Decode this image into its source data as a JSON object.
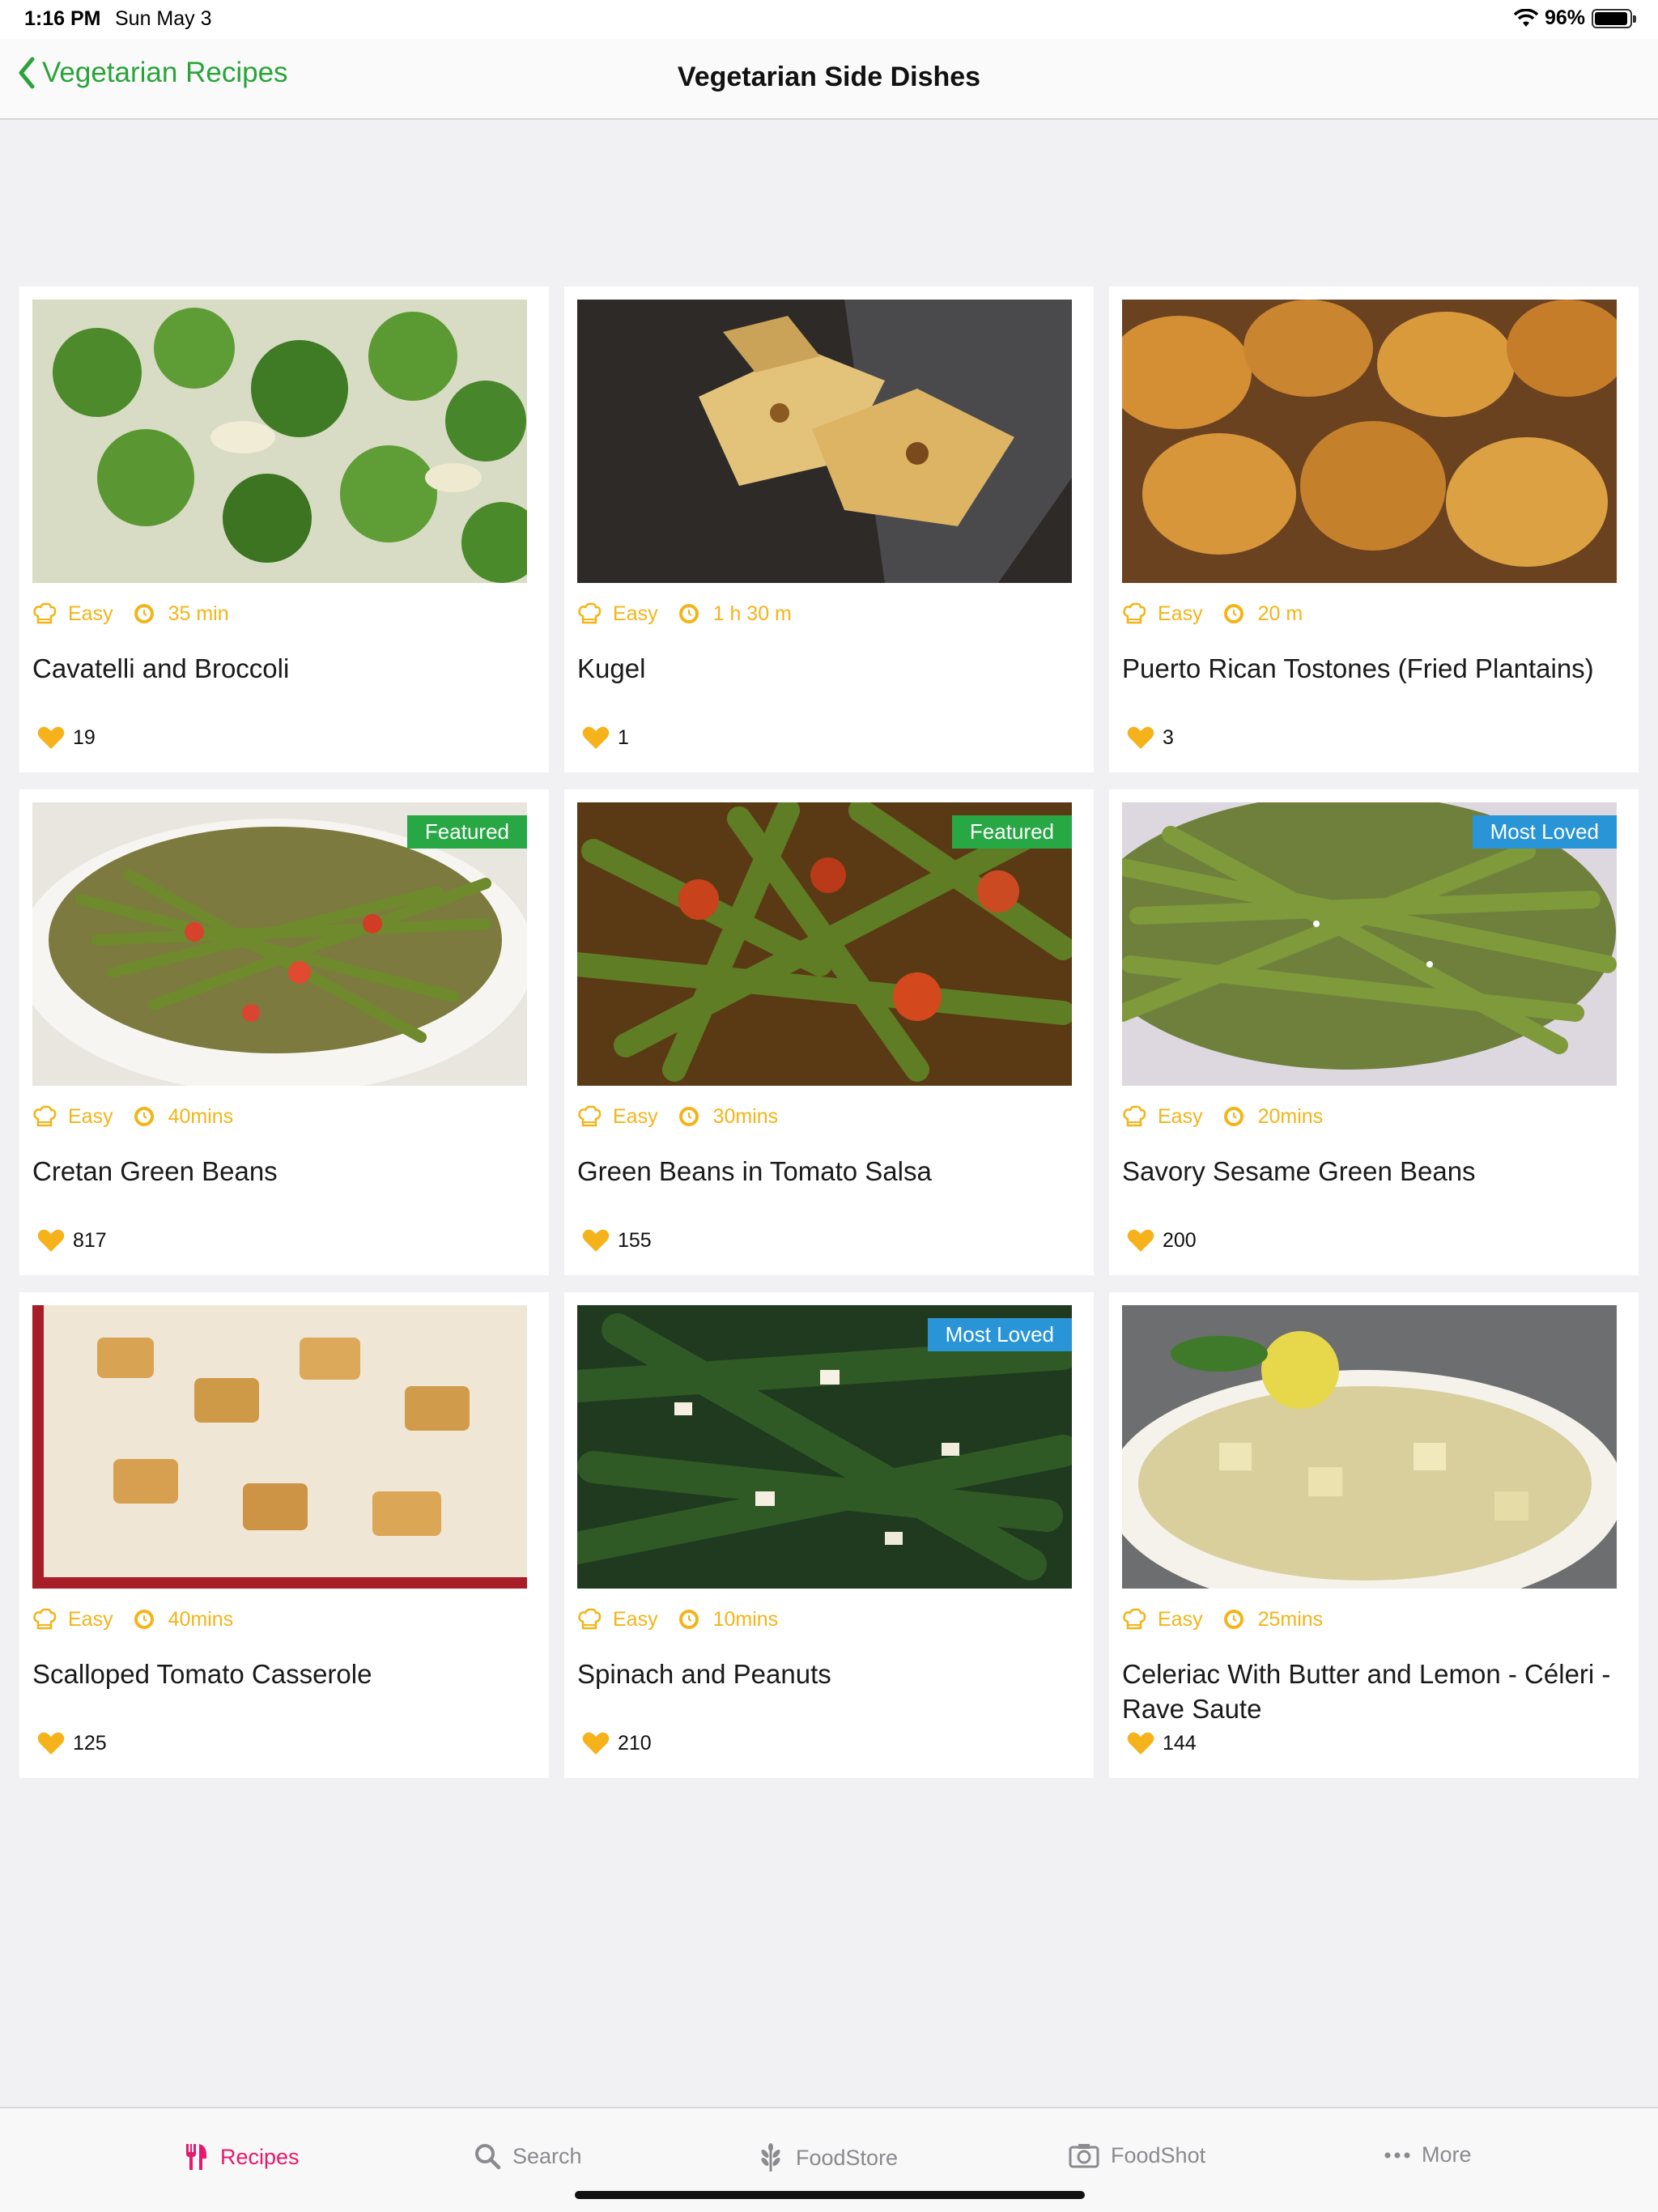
{
  "status_bar": {
    "time": "1:16 PM",
    "date": "Sun May 3",
    "battery": "96%",
    "battery_level": 0.96
  },
  "nav": {
    "back_label": "Vegetarian Recipes",
    "title": "Vegetarian Side Dishes"
  },
  "colors": {
    "accent_green": "#2aa33a",
    "meta_orange": "#f3b417",
    "featured": "#28a745",
    "most_loved": "#2a95d6",
    "active_tab": "#e6196f"
  },
  "recipes": [
    {
      "difficulty": "Easy",
      "time": "35 min",
      "title": "Cavatelli and Broccoli",
      "likes": "19",
      "badge": ""
    },
    {
      "difficulty": "Easy",
      "time": "1 h 30 m",
      "title": "Kugel",
      "likes": "1",
      "badge": ""
    },
    {
      "difficulty": "Easy",
      "time": "20 m",
      "title": "Puerto Rican Tostones (Fried Plantains)",
      "likes": "3",
      "badge": ""
    },
    {
      "difficulty": "Easy",
      "time": "40mins",
      "title": "Cretan Green Beans",
      "likes": "817",
      "badge": "Featured"
    },
    {
      "difficulty": "Easy",
      "time": "30mins",
      "title": "Green Beans in Tomato Salsa",
      "likes": "155",
      "badge": "Featured"
    },
    {
      "difficulty": "Easy",
      "time": "20mins",
      "title": "Savory Sesame Green Beans",
      "likes": "200",
      "badge": "Most Loved"
    },
    {
      "difficulty": "Easy",
      "time": "40mins",
      "title": "Scalloped Tomato Casserole",
      "likes": "125",
      "badge": ""
    },
    {
      "difficulty": "Easy",
      "time": "10mins",
      "title": "Spinach and Peanuts",
      "likes": "210",
      "badge": "Most Loved"
    },
    {
      "difficulty": "Easy",
      "time": "25mins",
      "title": "Celeriac With Butter and Lemon - Céleri - Rave Saute",
      "likes": "144",
      "badge": ""
    }
  ],
  "tabs": [
    {
      "label": "Recipes",
      "icon": "fork-knife-icon",
      "active": true
    },
    {
      "label": "Search",
      "icon": "search-icon",
      "active": false
    },
    {
      "label": "FoodStore",
      "icon": "wheat-icon",
      "active": false
    },
    {
      "label": "FoodShot",
      "icon": "camera-icon",
      "active": false
    },
    {
      "label": "More",
      "icon": "more-dots-icon",
      "active": false
    }
  ]
}
